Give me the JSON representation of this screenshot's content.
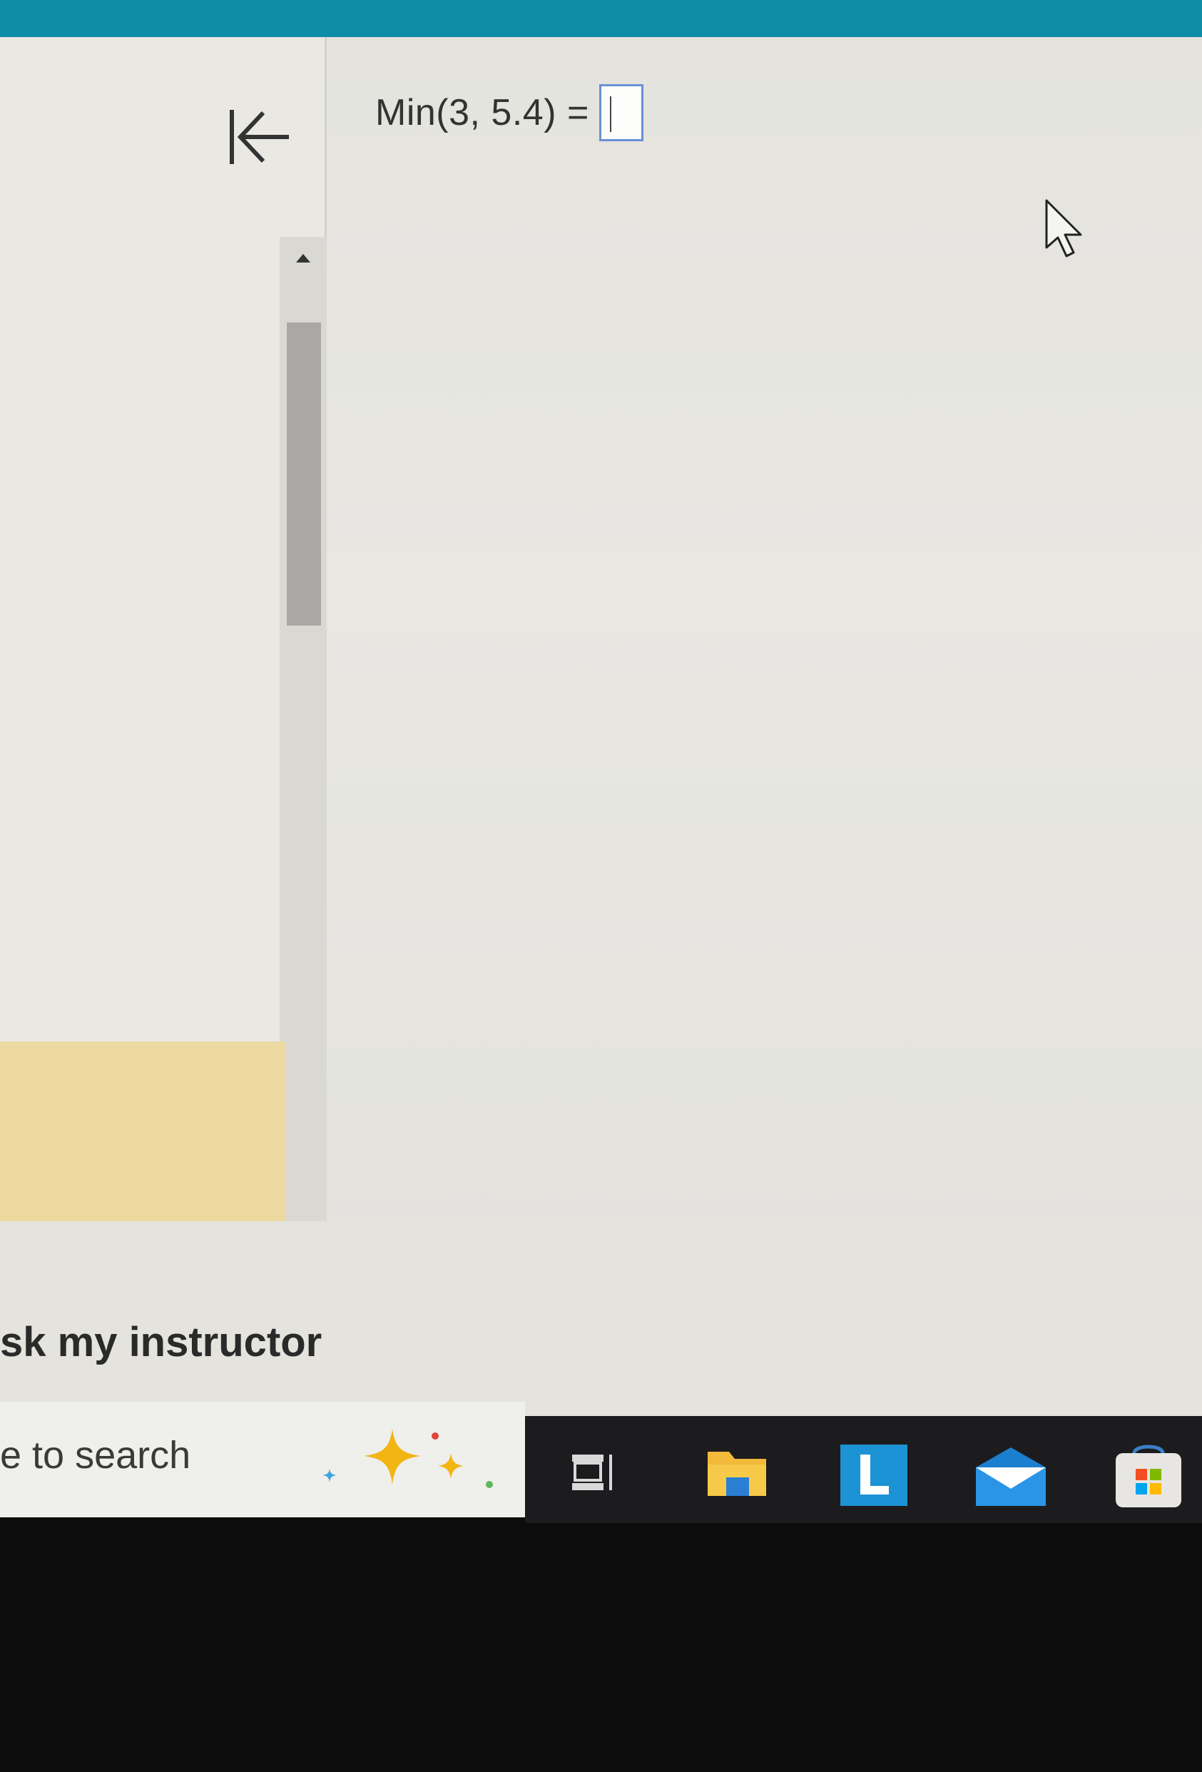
{
  "question": {
    "expression": "Min(3, 5.4) =",
    "answer_value": ""
  },
  "footer": {
    "ask_instructor": "sk my instructor"
  },
  "taskbar": {
    "search_text": "e to search",
    "apps": [
      "task-view-icon",
      "file-explorer-icon",
      "l-app-icon",
      "mail-icon",
      "store-icon"
    ]
  },
  "colors": {
    "topbar": "#0f8ca6",
    "highlight_panel": "#ecd9a0",
    "answer_border": "#6b8fd6",
    "taskbar": "#1c1c1e"
  }
}
